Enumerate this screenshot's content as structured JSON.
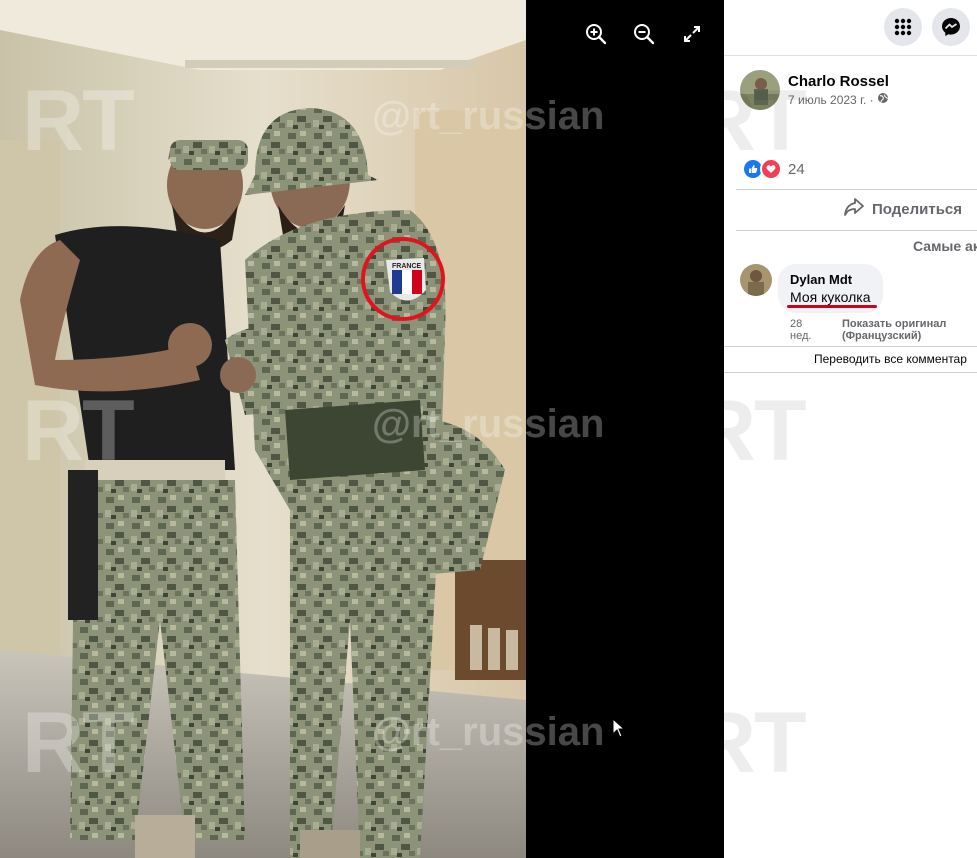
{
  "viewer": {
    "tools": [
      {
        "name": "zoom-in-icon"
      },
      {
        "name": "zoom-out-icon"
      },
      {
        "name": "fullscreen-icon"
      }
    ],
    "patch_label": "FRANCE"
  },
  "watermark": {
    "brand": "RT",
    "handle": "@rt_russian"
  },
  "panel": {
    "topbar": {
      "menu_icon": "grid-menu-icon",
      "messenger_icon": "messenger-icon"
    },
    "post": {
      "author": "Charlo Rossel",
      "date": "7 июль 2023 г. ·",
      "privacy_icon": "globe-icon",
      "reaction_count": "24",
      "share_label": "Поделиться",
      "sort_label": "Самые ак"
    },
    "comment": {
      "author": "Dylan Mdt",
      "text": "Моя куколка",
      "time": "28 нед.",
      "show_original": "Показать оригинал (Французский)"
    },
    "translate_all": "Переводить все комментар"
  },
  "colors": {
    "accent": "#1877f2",
    "love": "#f33e58",
    "highlight_red": "#d0021b",
    "text_secondary": "#65676b"
  }
}
